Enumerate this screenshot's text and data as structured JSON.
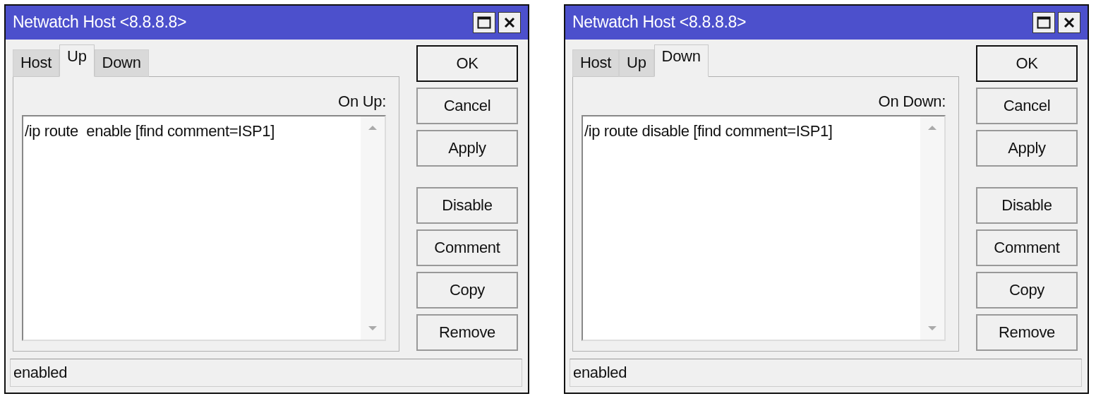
{
  "windows": [
    {
      "title": "Netwatch Host <8.8.8.8>",
      "tabs": [
        {
          "label": "Host",
          "selected": false
        },
        {
          "label": "Up",
          "selected": true
        },
        {
          "label": "Down",
          "selected": false
        }
      ],
      "field_label": "On Up:",
      "script": "/ip route  enable [find comment=ISP1]",
      "dialog_buttons": [
        {
          "label": "OK",
          "default": true
        },
        {
          "label": "Cancel",
          "default": false
        },
        {
          "label": "Apply",
          "default": false
        }
      ],
      "action_buttons": [
        "Disable",
        "Comment",
        "Copy",
        "Remove"
      ],
      "status": "enabled"
    },
    {
      "title": "Netwatch Host <8.8.8.8>",
      "tabs": [
        {
          "label": "Host",
          "selected": false
        },
        {
          "label": "Up",
          "selected": false
        },
        {
          "label": "Down",
          "selected": true
        }
      ],
      "field_label": "On Down:",
      "script": "/ip route disable [find comment=ISP1]",
      "dialog_buttons": [
        {
          "label": "OK",
          "default": true
        },
        {
          "label": "Cancel",
          "default": false
        },
        {
          "label": "Apply",
          "default": false
        }
      ],
      "action_buttons": [
        "Disable",
        "Comment",
        "Copy",
        "Remove"
      ],
      "status": "enabled"
    }
  ]
}
